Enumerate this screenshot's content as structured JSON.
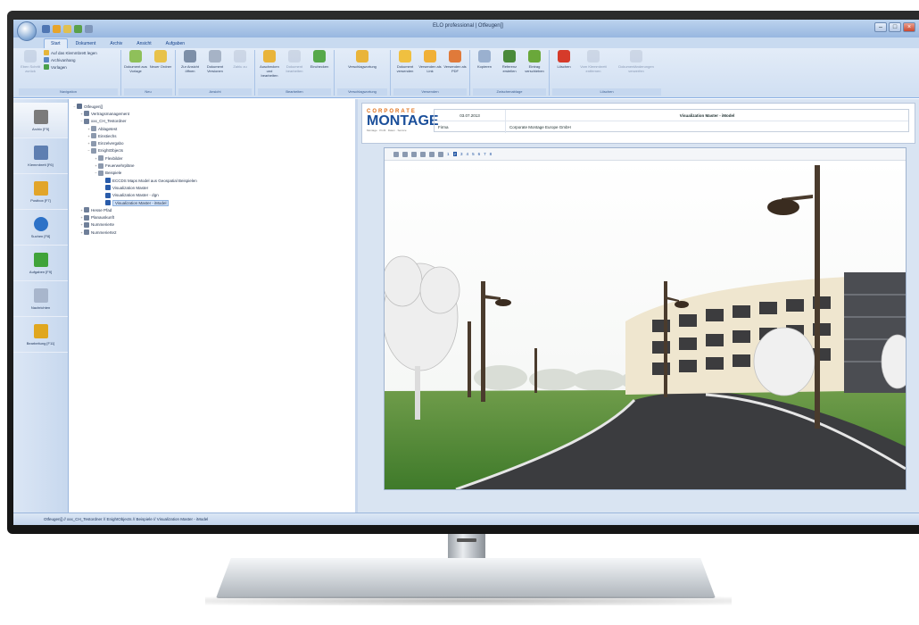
{
  "window": {
    "title": "ELO professional | Otfeugen[]",
    "controls": [
      "–",
      "□",
      "×"
    ]
  },
  "ribbon_tabs": [
    "Start",
    "Dokument",
    "Archiv",
    "Ansicht",
    "Aufgaben"
  ],
  "ribbon_groups": [
    {
      "label": "Navigation",
      "small": [
        "Auf das Klemmbrett legen",
        "Archivanhang",
        "Vorlagen"
      ],
      "buttons": [
        {
          "label": "Eben Schritt zurück",
          "disabled": true
        }
      ]
    },
    {
      "label": "Neu",
      "buttons": [
        {
          "label": "Dokument aus Vorlage"
        },
        {
          "label": "Neuer Ordner"
        }
      ]
    },
    {
      "label": "Ansicht",
      "buttons": [
        {
          "label": "Zur Ansicht öffnen"
        },
        {
          "label": "Dokument Versionen"
        },
        {
          "label": "Zahlu zu",
          "disabled": true
        }
      ]
    },
    {
      "label": "Bearbeiten",
      "buttons": [
        {
          "label": "Auschecken und bearbeiten"
        },
        {
          "label": "Dokument bearbeiten",
          "disabled": true
        },
        {
          "label": "Einchecken"
        }
      ]
    },
    {
      "label": "Verschlagwortung",
      "buttons": [
        {
          "label": "Verschlagwortung"
        }
      ]
    },
    {
      "label": "Versenden",
      "buttons": [
        {
          "label": "Dokument versenden"
        },
        {
          "label": "Versenden als Link"
        },
        {
          "label": "Versenden als PDF"
        }
      ]
    },
    {
      "label": "Zwischenablage",
      "buttons": [
        {
          "label": "Kopieren"
        },
        {
          "label": "Referenz erstellen"
        },
        {
          "label": "Eintrag verschieben"
        }
      ]
    },
    {
      "label": "Löschen",
      "buttons": [
        {
          "label": "Löschen"
        },
        {
          "label": "Vom Klemmbrett entfernen",
          "disabled": true
        },
        {
          "label": "Dokumentänderungen verwerfen",
          "disabled": true
        }
      ]
    }
  ],
  "nav_items": [
    {
      "label": "Archiv [F5]",
      "color": "#7b7b7b"
    },
    {
      "label": "Klemmbrett [F6]",
      "color": "#5e7fb1"
    },
    {
      "label": "Postbox [F7]",
      "color": "#e2a52a"
    },
    {
      "label": "Suchen [F8]",
      "color": "#2d72c7"
    },
    {
      "label": "Aufgaben [F9]",
      "color": "#3fa33a"
    },
    {
      "label": "Nachrichten",
      "color": "#a8b6cc"
    },
    {
      "label": "Bearbeitung [F11]",
      "color": "#e0a71f"
    }
  ],
  "tree": [
    {
      "depth": 0,
      "exp": "−",
      "label": "Otfeugen[]",
      "icon": "#5d6f8c"
    },
    {
      "depth": 1,
      "exp": "+",
      "label": "Vertragsmanagement",
      "icon": "#6f7f99"
    },
    {
      "depth": 1,
      "exp": "−",
      "label": "xxx_CH_Testordner",
      "icon": "#6f7f99"
    },
    {
      "depth": 2,
      "exp": "+",
      "label": "Ablagetest",
      "icon": "#8c99ad"
    },
    {
      "depth": 2,
      "exp": "+",
      "label": "Einstiechs",
      "icon": "#8c99ad"
    },
    {
      "depth": 2,
      "exp": "+",
      "label": "Einzelvergabo",
      "icon": "#8c99ad"
    },
    {
      "depth": 2,
      "exp": "−",
      "label": "EnightObjects",
      "icon": "#8c99ad"
    },
    {
      "depth": 3,
      "exp": "+",
      "label": "Flexbilder",
      "icon": "#8c99ad"
    },
    {
      "depth": 3,
      "exp": "+",
      "label": "Feuerwehrpläne",
      "icon": "#8c99ad"
    },
    {
      "depth": 3,
      "exp": "−",
      "label": "Beispiele",
      "icon": "#8c99ad"
    },
    {
      "depth": 4,
      "exp": "",
      "label": "ECCDS Maps Model aus Geospatial Beispielen",
      "icon": "#2a5caa"
    },
    {
      "depth": 4,
      "exp": "",
      "label": "Visualization Master",
      "icon": "#2a5caa"
    },
    {
      "depth": 4,
      "exp": "",
      "label": "Visualization Master - dgn",
      "icon": "#2a5caa"
    },
    {
      "depth": 4,
      "exp": "",
      "label": "Visualization Master - iModel",
      "icon": "#2a5caa",
      "selected": true
    },
    {
      "depth": 1,
      "exp": "+",
      "label": "Hesse Pfad",
      "icon": "#6f7f99"
    },
    {
      "depth": 1,
      "exp": "+",
      "label": "Planauskunft",
      "icon": "#6f7f99"
    },
    {
      "depth": 1,
      "exp": "+",
      "label": "Nummerierte",
      "icon": "#6f7f99"
    },
    {
      "depth": 1,
      "exp": "+",
      "label": "Nummerierte2",
      "icon": "#6f7f99"
    }
  ],
  "header": {
    "logo_top": "CORPORATE",
    "logo_main": "MONTAGE",
    "logo_sub": "Montage · Profil · Daten · Service",
    "date": "03.07.2013",
    "title": "Visualization Master - iModel",
    "field_label": "Firma",
    "field_value": "Corporate Montage Europe GmbH"
  },
  "viewer": {
    "pages": [
      "1",
      "2",
      "3",
      "4",
      "5",
      "6",
      "7",
      "8"
    ],
    "active_page": "2"
  },
  "statusbar": {
    "path": "Otfeugen[] // xxx_CH_Testordner // EnightObjects // Beispiele // Visualization Master - iModel"
  }
}
